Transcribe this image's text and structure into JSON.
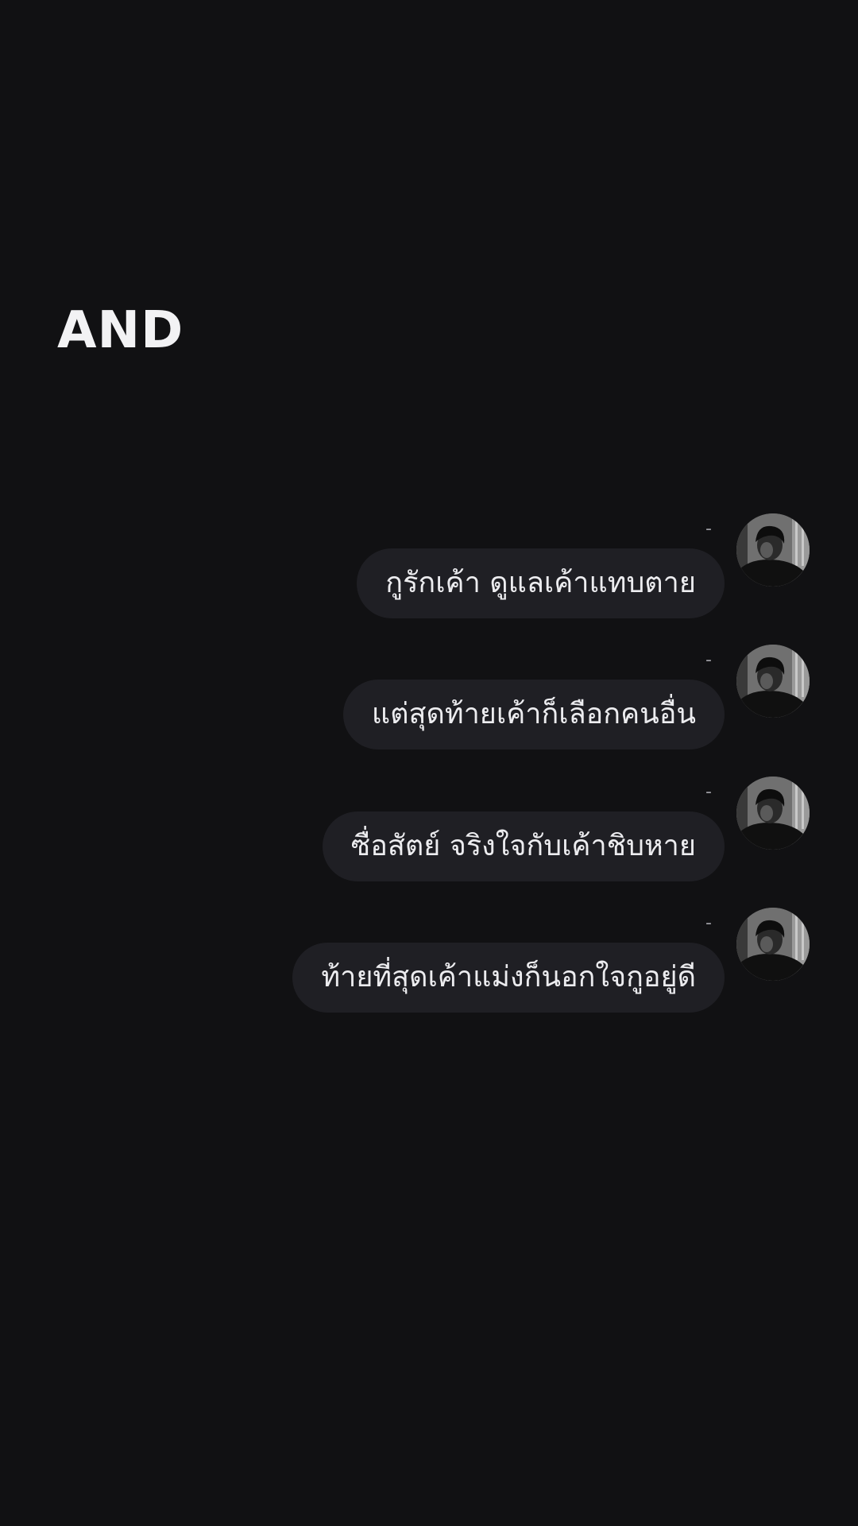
{
  "heading": "AND",
  "messages": [
    {
      "sender": "-",
      "text": "กูรักเค้า ดูแลเค้าแทบตาย",
      "avatar_icon": "profile-photo-icon"
    },
    {
      "sender": "-",
      "text": "แต่สุดท้ายเค้าก็เลือกคนอื่น",
      "avatar_icon": "profile-photo-icon"
    },
    {
      "sender": "-",
      "text": "ซื่อสัตย์ จริงใจกับเค้าชิบหาย",
      "avatar_icon": "profile-photo-icon"
    },
    {
      "sender": "-",
      "text": "ท้ายที่สุดเค้าแม่งก็นอกใจกูอยู่ดี",
      "avatar_icon": "profile-photo-icon"
    }
  ],
  "colors": {
    "background": "#111113",
    "bubble": "#1f1f24",
    "text": "#ececef",
    "sender": "#9a9aa0"
  }
}
